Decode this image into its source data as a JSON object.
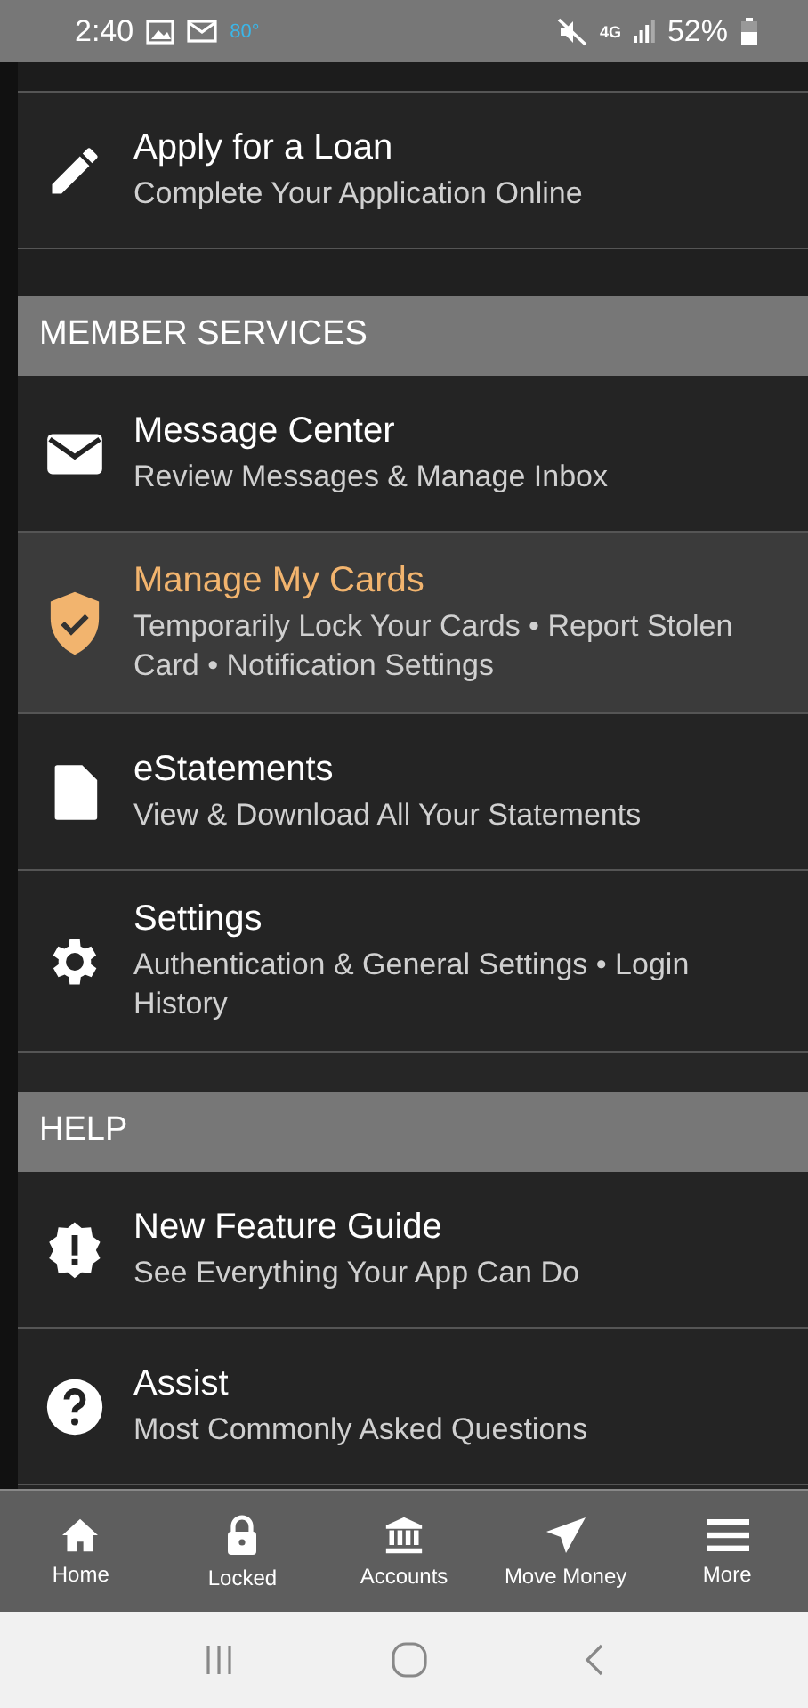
{
  "status_bar": {
    "time": "2:40",
    "temperature": "80°",
    "network": "4G",
    "battery": "52%"
  },
  "sections": [
    {
      "items": [
        {
          "title": "Apply for a Loan",
          "subtitle": "Complete Your Application Online",
          "selected": false
        }
      ]
    },
    {
      "header": "MEMBER SERVICES",
      "items": [
        {
          "title": "Message Center",
          "subtitle": "Review Messages & Manage Inbox",
          "selected": false
        },
        {
          "title": "Manage My Cards",
          "subtitle": "Temporarily Lock Your Cards • Report Stolen Card • Notification Settings",
          "selected": true
        },
        {
          "title": "eStatements",
          "subtitle": "View & Download All Your Statements",
          "selected": false
        },
        {
          "title": "Settings",
          "subtitle": "Authentication & General Settings • Login History",
          "selected": false
        }
      ]
    },
    {
      "header": "HELP",
      "items": [
        {
          "title": "New Feature Guide",
          "subtitle": "See Everything Your App Can Do",
          "selected": false
        },
        {
          "title": "Assist",
          "subtitle": "Most Commonly Asked Questions",
          "selected": false
        }
      ]
    }
  ],
  "bottom_nav": [
    {
      "label": "Home"
    },
    {
      "label": "Locked"
    },
    {
      "label": "Accounts"
    },
    {
      "label": "Move Money"
    },
    {
      "label": "More"
    }
  ]
}
